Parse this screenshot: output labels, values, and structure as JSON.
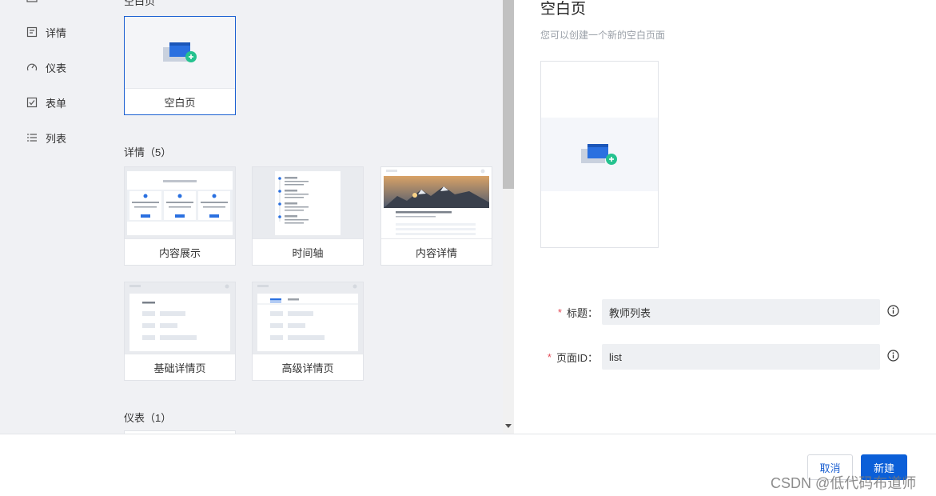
{
  "sidebar": {
    "items": [
      {
        "label": "",
        "icon": "layout-icon"
      },
      {
        "label": "详情",
        "icon": "document-icon"
      },
      {
        "label": "仪表",
        "icon": "dashboard-icon"
      },
      {
        "label": "表单",
        "icon": "checkbox-icon"
      },
      {
        "label": "列表",
        "icon": "list-icon"
      }
    ]
  },
  "templates": {
    "blank_section": "空白页",
    "blank_card": "空白页",
    "detail_section": "详情（5）",
    "detail_cards": [
      "内容展示",
      "时间轴",
      "内容详情",
      "基础详情页",
      "高级详情页"
    ],
    "dashboard_section": "仪表（1）"
  },
  "preview": {
    "title": "空白页",
    "description": "您可以创建一个新的空白页面"
  },
  "form": {
    "title_label": "标题：",
    "title_value": "教师列表",
    "page_id_label": "页面ID：",
    "page_id_value": "list",
    "required_mark": "*"
  },
  "footer": {
    "cancel_label": "取消",
    "create_label": "新建",
    "watermark": "CSDN @低代码布道师"
  },
  "colors": {
    "primary": "#0b5fd8",
    "required": "#e34d59",
    "panel_bg": "#f0f1f4"
  }
}
